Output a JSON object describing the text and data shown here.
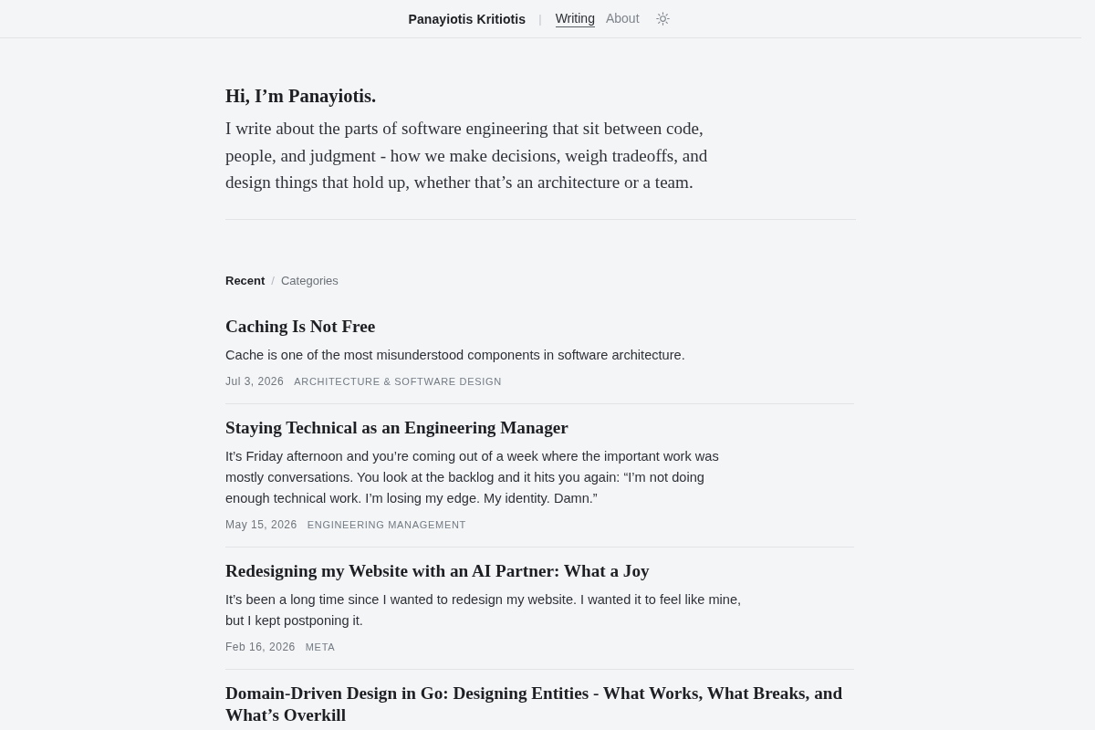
{
  "nav": {
    "site_title": "Panayiotis Kritiotis",
    "separator": "|",
    "links": [
      {
        "label": "Writing",
        "selected": true
      },
      {
        "label": "About",
        "selected": false
      }
    ]
  },
  "intro": {
    "heading": "Hi, I’m Panayiotis.",
    "text": "I write about the parts of software engineering that sit between code, people, and judgment - how we make decisions, weigh tradeoffs, and design things that hold up, whether that’s an architecture or a team."
  },
  "feed": {
    "tabs": [
      {
        "label": "Recent",
        "selected": true
      },
      {
        "label": "Categories",
        "selected": false
      }
    ],
    "tab_separator": "/",
    "posts": [
      {
        "title": "Caching Is Not Free",
        "excerpt": "Cache is one of the most misunderstood components in software architecture.",
        "date": "Jul 3, 2026",
        "category": "ARCHITECTURE & SOFTWARE DESIGN"
      },
      {
        "title": "Staying Technical as an Engineering Manager",
        "excerpt": "It’s Friday afternoon and you’re coming out of a week where the important work was mostly conversations. You look at the backlog and it hits you again: “I’m not doing enough technical work. I’m losing my edge. My identity. Damn.”",
        "date": "May 15, 2026",
        "category": "ENGINEERING MANAGEMENT"
      },
      {
        "title": "Redesigning my Website with an AI Partner: What a Joy",
        "excerpt": "It’s been a long time since I wanted to redesign my website. I wanted it to feel like mine, but I kept postponing it.",
        "date": "Feb 16, 2026",
        "category": "META"
      },
      {
        "title": "Domain-Driven Design in Go: Designing Entities - What Works, What Breaks, and What’s Overkill"
      }
    ]
  }
}
